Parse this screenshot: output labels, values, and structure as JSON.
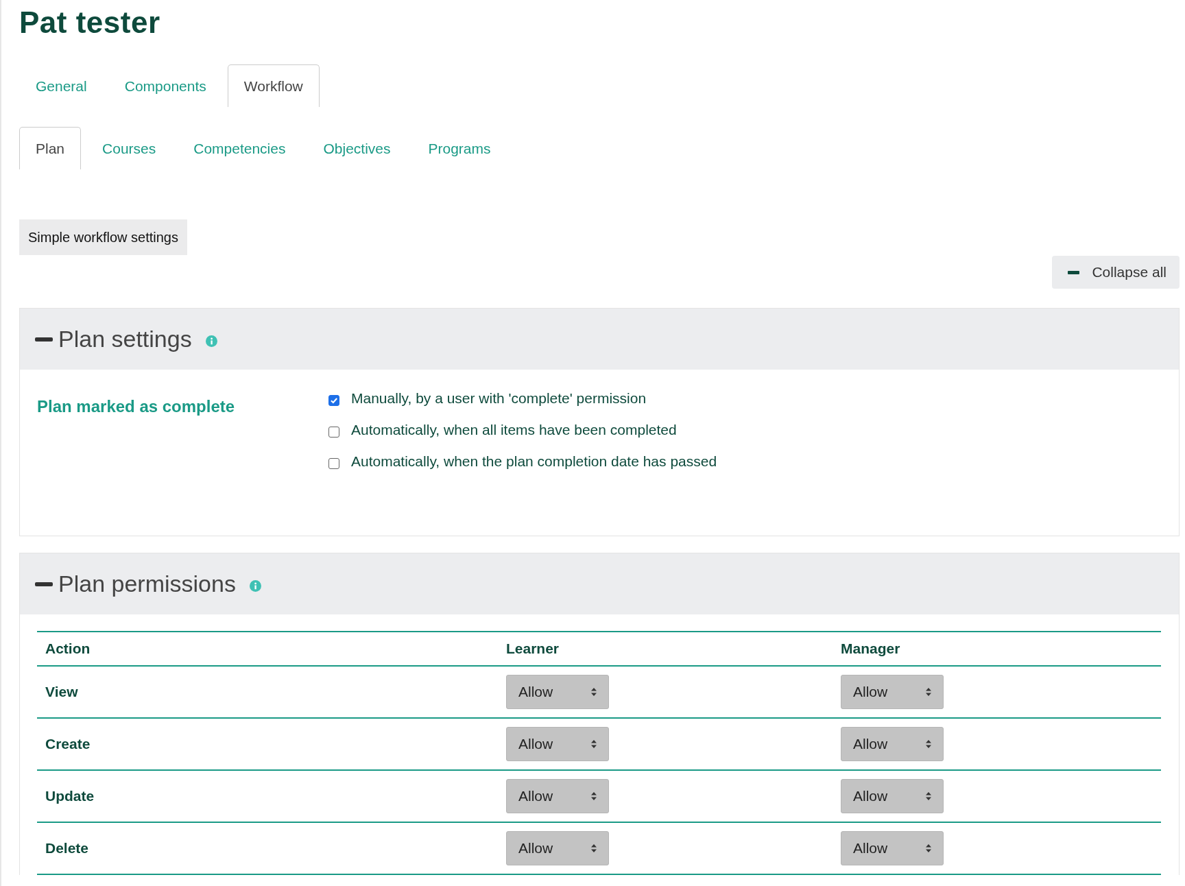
{
  "page_title": "Pat tester",
  "tabs": [
    {
      "label": "General",
      "selected": false
    },
    {
      "label": "Components",
      "selected": false
    },
    {
      "label": "Workflow",
      "selected": true
    }
  ],
  "subtabs": [
    {
      "label": "Plan",
      "selected": true
    },
    {
      "label": "Courses",
      "selected": false
    },
    {
      "label": "Competencies",
      "selected": false
    },
    {
      "label": "Objectives",
      "selected": false
    },
    {
      "label": "Programs",
      "selected": false
    }
  ],
  "simple_button": "Simple workflow settings",
  "collapse_button": "Collapse all",
  "plan_settings": {
    "title": "Plan settings",
    "expanded": true,
    "label": "Plan marked as complete",
    "options": [
      {
        "label": "Manually, by a user with 'complete' permission",
        "checked": true
      },
      {
        "label": "Automatically, when all items have been completed",
        "checked": false
      },
      {
        "label": "Automatically, when the plan completion date has passed",
        "checked": false
      }
    ]
  },
  "plan_permissions": {
    "title": "Plan permissions",
    "expanded": true,
    "columns": [
      "Action",
      "Learner",
      "Manager"
    ],
    "rows": [
      {
        "action": "View",
        "learner": "Allow",
        "manager": "Allow"
      },
      {
        "action": "Create",
        "learner": "Allow",
        "manager": "Allow"
      },
      {
        "action": "Update",
        "learner": "Allow",
        "manager": "Allow"
      },
      {
        "action": "Delete",
        "learner": "Allow",
        "manager": "Allow"
      }
    ]
  }
}
